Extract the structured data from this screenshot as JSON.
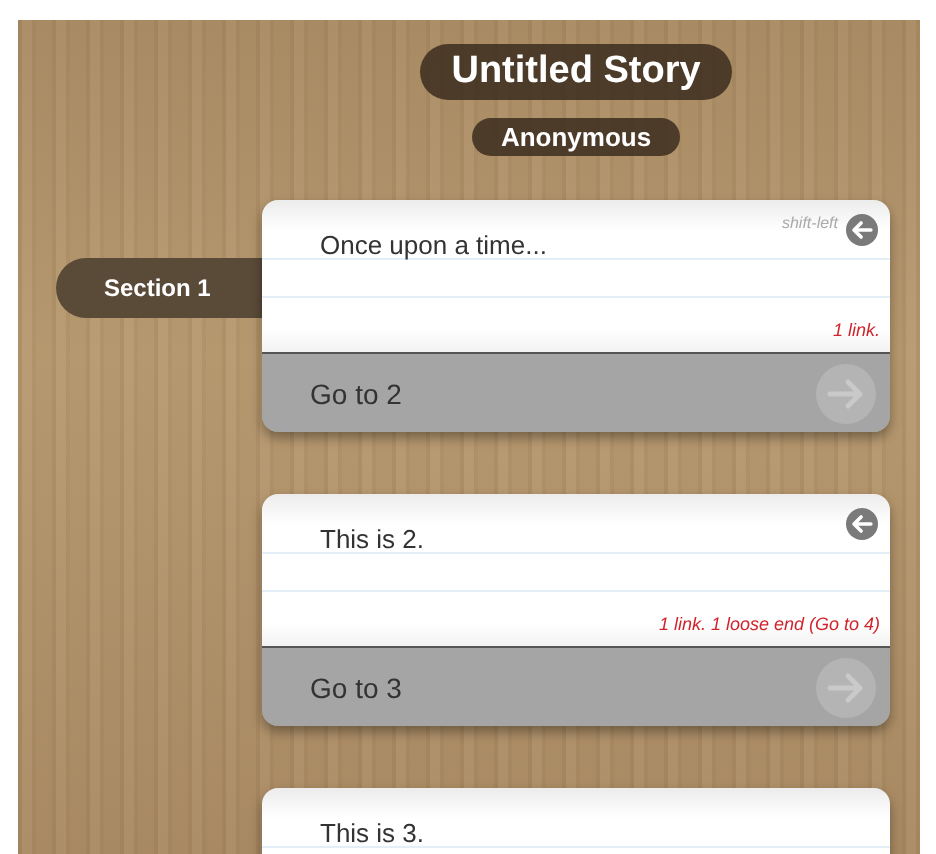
{
  "title": "Untitled Story",
  "author": "Anonymous",
  "sections": [
    {
      "label": "Section 1",
      "selected": true,
      "text": "Once upon a time...",
      "hint": "shift-left",
      "back_button": true,
      "status": "1 link.",
      "links": [
        "Go to 2"
      ]
    },
    {
      "selected": false,
      "text": "This is 2.",
      "back_button": true,
      "status": "1 link. 1 loose end (Go to 4)",
      "links": [
        "Go to 3"
      ]
    },
    {
      "selected": false,
      "text": "This is 3.",
      "back_button": false
    }
  ]
}
